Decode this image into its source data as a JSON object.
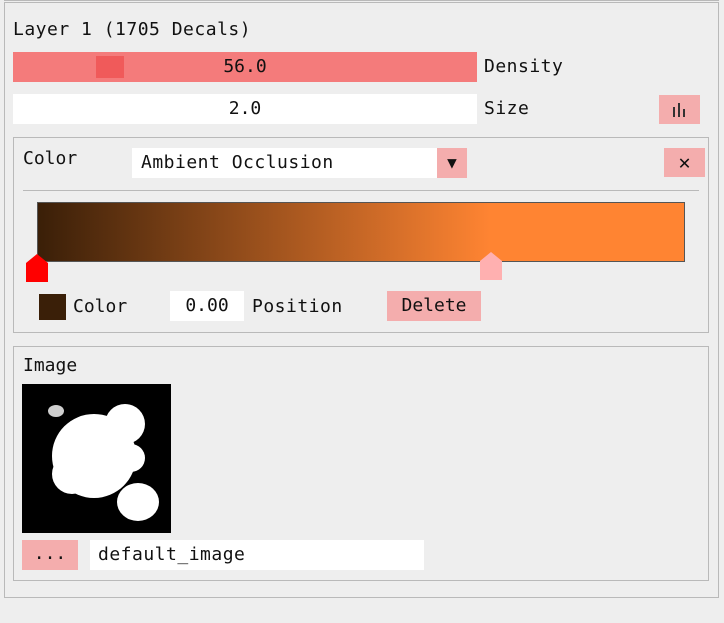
{
  "layer": {
    "title": "Layer 1 (1705 Decals)",
    "density": {
      "value": "56.0",
      "label": "Density",
      "fraction": 0.21
    },
    "size": {
      "value": "2.0",
      "label": "Size"
    },
    "histogram_icon": "bar-chart-icon"
  },
  "color_section": {
    "label": "Color",
    "dropdown": {
      "selected": "Ambient Occlusion",
      "arrow": "▼"
    },
    "close_glyph": "✕",
    "gradient": {
      "start_color": "#3a1f08",
      "end_color": "#ff8432",
      "stops": [
        {
          "position": 0.0,
          "color": "#3a1f08",
          "marker_color": "#ff0000"
        },
        {
          "position": 0.7,
          "color": "#ff8432",
          "marker_color": "#ffb0b0"
        }
      ]
    },
    "selected_stop": {
      "swatch_color": "#3a1f08",
      "color_label": "Color",
      "position_value": "0.00",
      "position_label": "Position",
      "delete_label": "Delete"
    }
  },
  "image_section": {
    "label": "Image",
    "browse_label": "...",
    "filename": "default_image"
  },
  "colors": {
    "accent": "#f4adad",
    "slider_fill": "#f47b7b",
    "slider_handle": "#f05a5a",
    "background": "#eeeeee"
  }
}
